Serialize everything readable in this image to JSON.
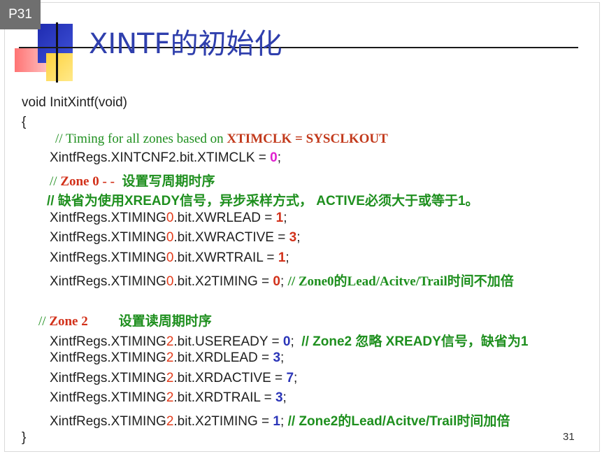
{
  "page_tag": "P31",
  "title": "XINTF的初始化",
  "page_number": "31",
  "code": {
    "func_decl": "void InitXintf(void)",
    "open_brace": "{",
    "close_brace": "}",
    "c1_prefix": "// Timing for all zones based on ",
    "c1_highlight": "XTIMCLK = SYSCLKOUT",
    "l1_main": "XintfRegs.XINTCNF2.bit.XTIMCLK = ",
    "l1_val": "0",
    "semicolon": ";",
    "zone0_prefix": "// ",
    "zone0_label": "Zone 0 -  -",
    "zone0_desc": "设置写周期时序",
    "zone0_note": "// 缺省为使用XREADY信号，异步采样方式， ACTIVE必须大于或等于1。",
    "reg_prefix": "XintfRegs.XTIMING",
    "zone0_num": "0",
    "zone2_num": "2",
    "l2_suffix": ".bit.XWRLEAD = ",
    "l2_val": "1",
    "l3_suffix": ".bit.XWRACTIVE = ",
    "l3_val": "3",
    "l4_suffix": ".bit.XWRTRAIL = ",
    "l4_val": "1",
    "l5_suffix": ".bit.X2TIMING = ",
    "l5_val": "0",
    "l5_comment": "// Zone0的Lead/Acitve/Trail时间不加倍",
    "zone2_prefix": "// ",
    "zone2_label": "Zone 2",
    "zone2_desc": "设置读周期时序",
    "l6_suffix": ".bit.USEREADY = ",
    "l6_val": "0",
    "l6_comment": "// Zone2 忽略 XREADY信号，缺省为1",
    "l7_suffix": ".bit.XRDLEAD = ",
    "l7_val": "3",
    "l8_suffix": ".bit.XRDACTIVE = ",
    "l8_val": "7",
    "l9_suffix": ".bit.XRDTRAIL = ",
    "l9_val": "3",
    "l10_suffix": ".bit.X2TIMING = ",
    "l10_val": "1",
    "l10_comment": "// Zone2的Lead/Acitve/Trail时间加倍"
  },
  "colors": {
    "title": "#2f3fad",
    "comment_green": "#1e8f1e",
    "zone_red": "#d2311a",
    "value_magenta": "#e020d0",
    "value_blue": "#2b35b8",
    "value_red": "#d2311a"
  }
}
